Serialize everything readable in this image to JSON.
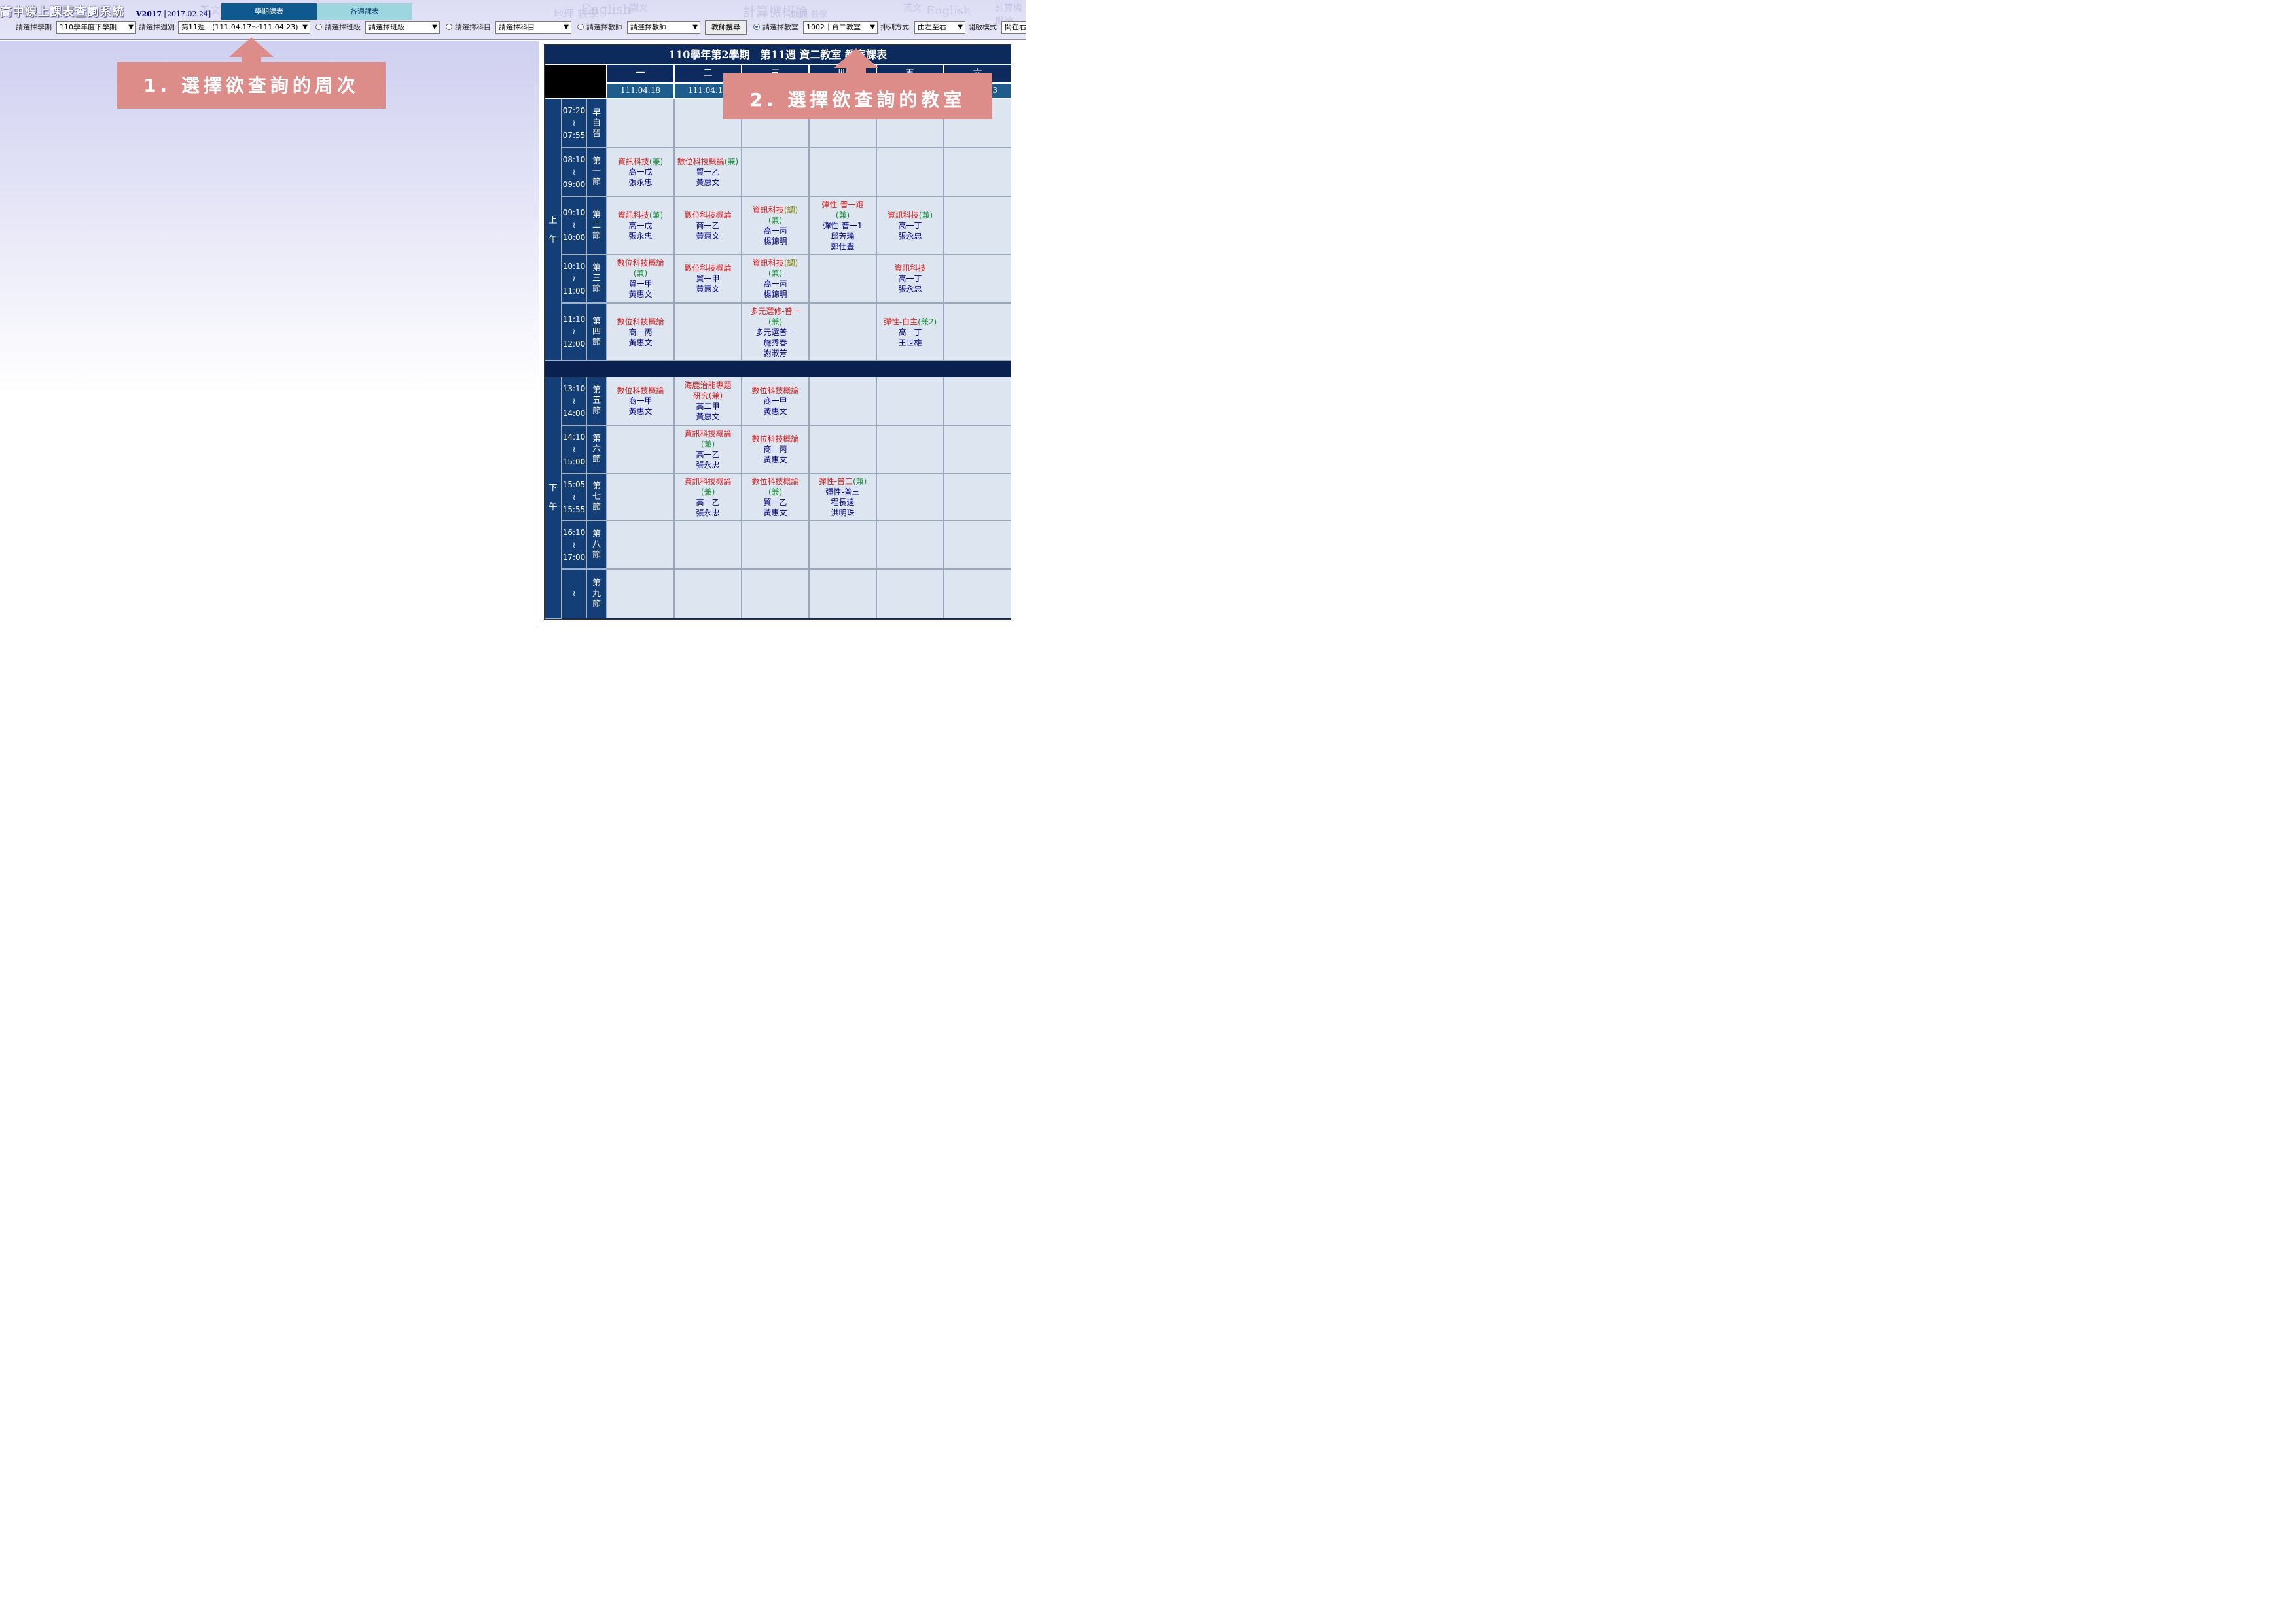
{
  "header": {
    "app_title": "高中線上課表查詢系統",
    "version": "V2017",
    "version_date": "[2017.02.24]",
    "tabs": [
      {
        "label": "學期課表",
        "active": true
      },
      {
        "label": "各週課表",
        "active": false
      }
    ],
    "background_words": [
      "英文",
      "地理 數學",
      "English",
      "國文",
      "計算機概論",
      "地理 數學",
      "英文",
      "English",
      "計算機概論"
    ]
  },
  "controls": {
    "semester_label": "請選擇學期",
    "semester_value": "110學年度下學期",
    "week_label": "請選擇週別",
    "week_value": "第11週　(111.04.17～111.04.23)",
    "class_label": "請選擇班級",
    "class_value": "請選擇班級",
    "subject_label": "請選擇科目",
    "subject_value": "請選擇科目",
    "teacher_label": "請選擇教師",
    "teacher_value": "請選擇教師",
    "teacher_search_label": "教師搜尋",
    "room_label": "請選擇教室",
    "room_value": "1002｜資二教室",
    "sort_label": "排列方式",
    "sort_value": "由左至右",
    "open_label": "開啟模式",
    "open_value": "開在右"
  },
  "callouts": {
    "week": "1. 選擇欲查詢的周次",
    "room": "2. 選擇欲查詢的教室"
  },
  "schedule": {
    "title": "110學年第2學期　第11週 資二教室 教室課表",
    "days": [
      "一",
      "二",
      "三",
      "四",
      "五",
      "六"
    ],
    "dates": [
      "111.04.18",
      "111.04.19",
      "",
      "",
      "",
      "111.04.23"
    ],
    "halves": [
      "上午",
      "下午"
    ],
    "periods": [
      {
        "name": "早自習",
        "start": "07:20",
        "sep": "≀",
        "end": "07:55"
      },
      {
        "name": "第一節",
        "start": "08:10",
        "sep": "≀",
        "end": "09:00"
      },
      {
        "name": "第二節",
        "start": "09:10",
        "sep": "≀",
        "end": "10:00"
      },
      {
        "name": "第三節",
        "start": "10:10",
        "sep": "≀",
        "end": "11:00"
      },
      {
        "name": "第四節",
        "start": "11:10",
        "sep": "≀",
        "end": "12:00"
      },
      {
        "name": "第五節",
        "start": "13:10",
        "sep": "≀",
        "end": "14:00"
      },
      {
        "name": "第六節",
        "start": "14:10",
        "sep": "≀",
        "end": "15:00"
      },
      {
        "name": "第七節",
        "start": "15:05",
        "sep": "≀",
        "end": "15:55"
      },
      {
        "name": "第八節",
        "start": "16:10",
        "sep": "≀",
        "end": "17:00"
      },
      {
        "name": "第九節",
        "start": "",
        "sep": "≀",
        "end": ""
      }
    ],
    "cells": [
      {
        "period": 1,
        "day": 0,
        "subject": "資訊科技",
        "mark": "(兼)",
        "kind": "pm",
        "lines": [
          "高一戊",
          "張永忠"
        ]
      },
      {
        "period": 1,
        "day": 1,
        "subject": "數位科技概論",
        "mark": "(兼)",
        "kind": "pm",
        "lines": [
          "貿一乙",
          "黃惠文"
        ]
      },
      {
        "period": 2,
        "day": 0,
        "subject": "資訊科技",
        "mark": "(兼)",
        "kind": "pm",
        "lines": [
          "高一戊",
          "張永忠"
        ]
      },
      {
        "period": 2,
        "day": 1,
        "subject": "數位科技概論",
        "mark": "",
        "kind": "",
        "lines": [
          "商一乙",
          "黃惠文"
        ]
      },
      {
        "period": 2,
        "day": 2,
        "subject": "資訊科技",
        "mark": "(調)",
        "kind": "pe",
        "lines": [
          "(兼)",
          "高一丙",
          "楊錦明"
        ]
      },
      {
        "period": 2,
        "day": 3,
        "subject": "彈性-普一跑",
        "mark": "",
        "kind": "",
        "lines": [
          "(兼)",
          "彈性-普一1",
          "邱芳瑜",
          "鄭仕豐"
        ]
      },
      {
        "period": 2,
        "day": 4,
        "subject": "資訊科技",
        "mark": "(兼)",
        "kind": "pm",
        "lines": [
          "高一丁",
          "張永忠"
        ]
      },
      {
        "period": 3,
        "day": 0,
        "subject": "數位科技概論",
        "mark": "",
        "kind": "",
        "lines": [
          "(兼)",
          "貿一甲",
          "黃惠文"
        ]
      },
      {
        "period": 3,
        "day": 1,
        "subject": "數位科技概論",
        "mark": "",
        "kind": "",
        "lines": [
          "貿一甲",
          "黃惠文"
        ]
      },
      {
        "period": 3,
        "day": 2,
        "subject": "資訊科技",
        "mark": "(調)",
        "kind": "pe",
        "lines": [
          "(兼)",
          "高一丙",
          "楊錦明"
        ]
      },
      {
        "period": 3,
        "day": 4,
        "subject": "資訊科技",
        "mark": "",
        "kind": "",
        "lines": [
          "高一丁",
          "張永忠"
        ]
      },
      {
        "period": 4,
        "day": 0,
        "subject": "數位科技概論",
        "mark": "",
        "kind": "",
        "lines": [
          "商一丙",
          "黃惠文"
        ]
      },
      {
        "period": 4,
        "day": 2,
        "subject": "多元選修-普一",
        "mark": "",
        "kind": "",
        "lines": [
          "(兼)",
          "多元選普一",
          "施秀春",
          "謝淑芳"
        ]
      },
      {
        "period": 4,
        "day": 4,
        "subject": "彈性-自主",
        "mark": "(兼2)",
        "kind": "pm",
        "lines": [
          "高一丁",
          "王世雄"
        ]
      },
      {
        "period": 5,
        "day": 0,
        "subject": "數位科技概論",
        "mark": "",
        "kind": "",
        "lines": [
          "商一甲",
          "黃惠文"
        ]
      },
      {
        "period": 5,
        "day": 1,
        "subject": "海鹿治能專題",
        "mark": "",
        "kind": "",
        "lines": [
          "研究(兼)",
          "高二甲",
          "黃惠文"
        ]
      },
      {
        "period": 5,
        "day": 2,
        "subject": "數位科技概論",
        "mark": "",
        "kind": "",
        "lines": [
          "商一甲",
          "黃惠文"
        ]
      },
      {
        "period": 6,
        "day": 1,
        "subject": "資訊科技概論",
        "mark": "",
        "kind": "",
        "lines": [
          "(兼)",
          "高一乙",
          "張永忠"
        ]
      },
      {
        "period": 6,
        "day": 2,
        "subject": "數位科技概論",
        "mark": "",
        "kind": "",
        "lines": [
          "商一丙",
          "黃惠文"
        ]
      },
      {
        "period": 7,
        "day": 1,
        "subject": "資訊科技概論",
        "mark": "",
        "kind": "",
        "lines": [
          "(兼)",
          "高一乙",
          "張永忠"
        ]
      },
      {
        "period": 7,
        "day": 2,
        "subject": "數位科技概論",
        "mark": "",
        "kind": "",
        "lines": [
          "(兼)",
          "貿一乙",
          "黃惠文"
        ]
      },
      {
        "period": 7,
        "day": 3,
        "subject": "彈性-普三",
        "mark": "(兼)",
        "kind": "pm",
        "lines": [
          "彈性-普三",
          "程長遠",
          "洪明珠"
        ]
      }
    ]
  },
  "colors": {
    "header_navy": "#0d2a5c",
    "cell_bg": "#dde6f0",
    "subject_red": "#d42020",
    "mark_green": "#1a8a3a",
    "class_navy": "#000080",
    "callout_pink": "#dc8d8a"
  }
}
